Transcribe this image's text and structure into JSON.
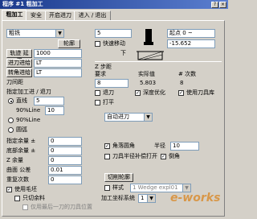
{
  "window": {
    "title": "程序 #1 粗加工"
  },
  "tabs": [
    "粗加工",
    "安全",
    "开启进刀",
    "进入 / 退出"
  ],
  "left": {
    "type_select": "粗铣",
    "btn_contour": "轮廓",
    "row1_label": "轨迹 延伸",
    "row1_value": "1000",
    "row2_label": "进刀进给",
    "row2_value": "LT",
    "row3_label": "转角进给",
    "row3_value": "LT",
    "knife_label": "刀间距",
    "feed_group_label": "指定加工进 / 退刀",
    "opt_straight": "直线",
    "opt_straight_value": "5",
    "opt_90": "90%Line",
    "opt_90_value": "10",
    "opt_90b": "90%Line",
    "opt_arc": "圆弧",
    "stock_label": "指定余量 ±",
    "stock_value": "0",
    "stock2_label": "底部余量 ±",
    "stock2_value": "0",
    "allowance_label": "Z 余量",
    "allowance_value": "0",
    "tol_label": "曲面 公差",
    "tol_value": "0.01",
    "sf_label": "重复次数",
    "sf_value": "0",
    "use_label": "使用毛坯",
    "only_label": "只切余料",
    "last_label": "仅用最后一刀的刀具位置"
  },
  "right": {
    "top_value1": "5",
    "fast_label": "快速移动",
    "down_label": "下",
    "step_value": "起点 0 ~",
    "z_value": "-15.652",
    "z_header": "Z 步距",
    "col1": "要求",
    "col2": "实际值",
    "col3": "# 次数",
    "req": "8",
    "act": "5.803",
    "cnt": "8",
    "chk_return": "退刀",
    "chk_depth": "深度优化",
    "chk_tool": "使用刀具库",
    "chk_one": "打平",
    "mode_select": "自动进刀",
    "corner_label": "角落圆角",
    "radius_label": "半径",
    "radius_value": "10",
    "tool_label": "刀具半径补偿打开",
    "thin_label": "倒角",
    "btn_contour": "切削轮廓",
    "style_label": "样式",
    "style_value": "1 Wedge expl01",
    "coord_label": "加工坐标系统",
    "coord_value": "1",
    "watermark": "e-works"
  }
}
